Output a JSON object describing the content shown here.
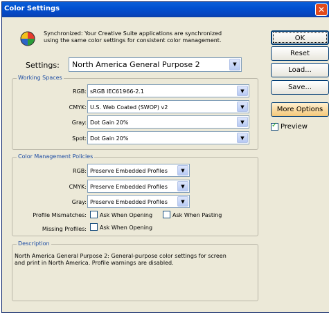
{
  "window": {
    "title": "Color Settings",
    "close_glyph": "✕"
  },
  "sync": {
    "icon": "sync-color-wheel-icon",
    "line1": "Synchronized: Your Creative Suite applications are synchronized",
    "line2": "using the same color settings for consistent color management."
  },
  "buttons": {
    "ok": "OK",
    "reset": "Reset",
    "load": "Load...",
    "save": "Save...",
    "more_options": "More Options"
  },
  "preview": {
    "label": "Preview",
    "checked": true
  },
  "settings": {
    "label": "Settings:",
    "value": "North America General Purpose 2"
  },
  "working_spaces": {
    "title": "Working Spaces",
    "rows": [
      {
        "label": "RGB:",
        "value": "sRGB IEC61966-2.1"
      },
      {
        "label": "CMYK:",
        "value": "U.S. Web Coated (SWOP) v2"
      },
      {
        "label": "Gray:",
        "value": "Dot Gain 20%"
      },
      {
        "label": "Spot:",
        "value": "Dot Gain 20%"
      }
    ]
  },
  "policies": {
    "title": "Color Management Policies",
    "rows": [
      {
        "label": "RGB:",
        "value": "Preserve Embedded Profiles"
      },
      {
        "label": "CMYK:",
        "value": "Preserve Embedded Profiles"
      },
      {
        "label": "Gray:",
        "value": "Preserve Embedded Profiles"
      }
    ],
    "mismatch_label": "Profile Mismatches:",
    "ask_opening": "Ask When Opening",
    "ask_pasting": "Ask When Pasting",
    "missing_label": "Missing Profiles:",
    "ask_opening_missing": "Ask When Opening"
  },
  "description": {
    "title": "Description",
    "line1": "North America General Purpose 2:  General-purpose color settings for screen",
    "line2": "and print in North America. Profile warnings are disabled."
  },
  "colors": {
    "title_bar": "#0050d0",
    "dialog_bg": "#ece9d8",
    "legend_text": "#1b4ba3"
  }
}
